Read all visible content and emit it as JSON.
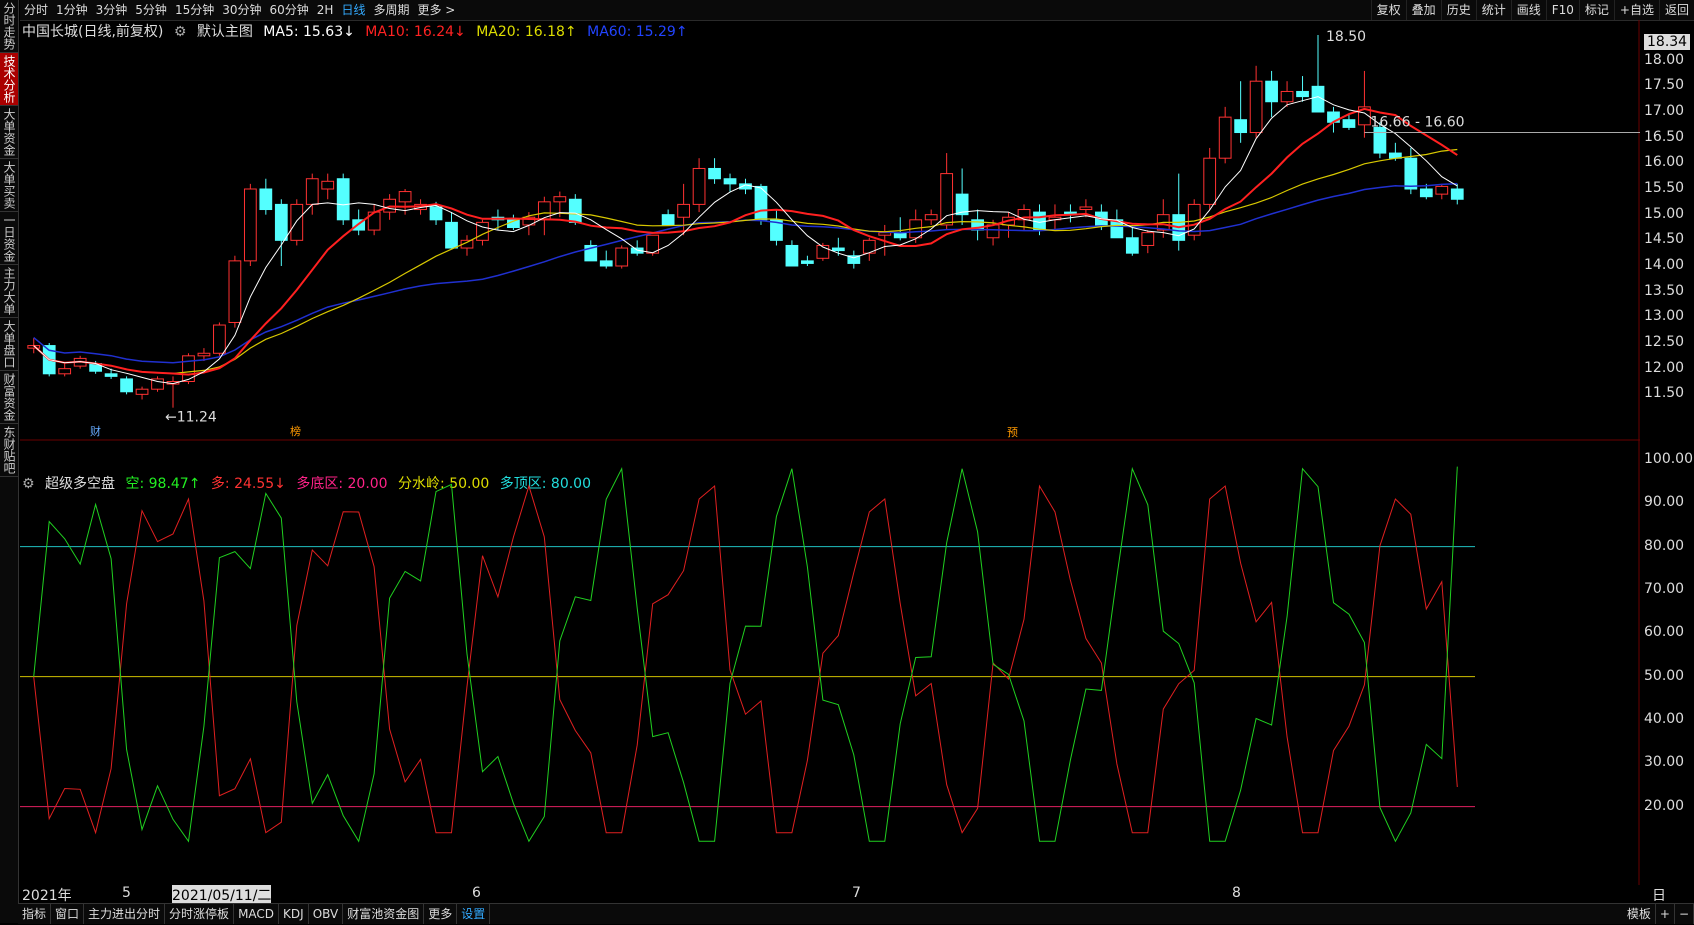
{
  "toolbar": {
    "left_items": [
      "分时",
      "1分钟",
      "3分钟",
      "5分钟",
      "15分钟",
      "30分钟",
      "60分钟",
      "2H",
      "日线",
      "多周期",
      "更多 >"
    ],
    "active_index": 8,
    "right_items": [
      "复权",
      "叠加",
      "历史",
      "统计",
      "画线",
      "F10",
      "标记",
      "+自选",
      "返回"
    ]
  },
  "sidebar": {
    "items": [
      "分时走势",
      "技术分析",
      "大单资金",
      "大单买卖",
      "一日资金",
      "主力大单",
      "大单盘口",
      "财富资金",
      "东财贴吧"
    ],
    "active_index": 1
  },
  "main_legend": {
    "stock": "中国长城(日线,前复权)",
    "template": "默认主图",
    "ma5": "MA5: 15.63↓",
    "ma10": "MA10: 16.24↓",
    "ma20": "MA20: 16.18↑",
    "ma60": "MA60: 15.29↑",
    "colors": {
      "ma5": "#ffffff",
      "ma10": "#ff2020",
      "ma20": "#e0d000",
      "ma60": "#2040ff"
    }
  },
  "sub_legend": {
    "name": "超级多空盘",
    "kong": "空: 98.47↑",
    "duo": "多: 24.55↓",
    "dudi": "多底区: 20.00",
    "fenshui": "分水岭: 50.00",
    "duoding": "多顶区: 80.00",
    "colors": {
      "kong": "#20e020",
      "duo": "#ff3030",
      "dudi": "#ff2080",
      "fenshui": "#e0d000",
      "duoding": "#20d0d0"
    }
  },
  "price_axis": {
    "current": "18.34",
    "ticks": [
      "18.00",
      "17.50",
      "17.00",
      "16.50",
      "16.00",
      "15.50",
      "15.00",
      "14.50",
      "14.00",
      "13.50",
      "13.00",
      "12.50",
      "12.00",
      "11.50"
    ]
  },
  "osc_axis": {
    "ticks": [
      "100.00",
      "90.00",
      "80.00",
      "70.00",
      "60.00",
      "50.00",
      "40.00",
      "30.00",
      "20.00"
    ]
  },
  "annotations": {
    "high": "18.50",
    "low": "11.24",
    "range_label": "16.66 - 16.60",
    "marker_cai": "财",
    "marker_bang": "榜",
    "marker_yu": "预"
  },
  "date_axis": {
    "labels": [
      "2021年",
      "5",
      "2021/05/11/二",
      "6",
      "7",
      "8"
    ],
    "right_label": "日线"
  },
  "bottom_tabs": {
    "items": [
      "指标",
      "窗口",
      "主力进出分时",
      "分时涨停板",
      "MACD",
      "KDJ",
      "OBV",
      "财富池资金图",
      "更多",
      "设置"
    ],
    "active_index": 9,
    "right_items": [
      "模板",
      "+",
      "−"
    ]
  },
  "chart_data": {
    "type": "candlestick",
    "price_range": [
      11.0,
      18.5
    ],
    "candles": [
      [
        12.4,
        12.6,
        12.3,
        12.45
      ],
      [
        12.45,
        12.5,
        11.85,
        11.9
      ],
      [
        11.9,
        12.1,
        11.85,
        12.0
      ],
      [
        12.05,
        12.25,
        12.0,
        12.2
      ],
      [
        12.1,
        12.15,
        11.9,
        11.95
      ],
      [
        11.9,
        12.0,
        11.8,
        11.85
      ],
      [
        11.8,
        11.85,
        11.5,
        11.55
      ],
      [
        11.5,
        11.65,
        11.4,
        11.6
      ],
      [
        11.6,
        11.85,
        11.55,
        11.8
      ],
      [
        11.7,
        11.85,
        11.24,
        11.75
      ],
      [
        11.75,
        12.3,
        11.7,
        12.25
      ],
      [
        12.25,
        12.4,
        12.15,
        12.3
      ],
      [
        12.3,
        12.9,
        12.25,
        12.85
      ],
      [
        12.9,
        14.2,
        12.8,
        14.1
      ],
      [
        14.1,
        15.6,
        14.0,
        15.5
      ],
      [
        15.5,
        15.7,
        15.0,
        15.1
      ],
      [
        15.2,
        15.3,
        14.0,
        14.5
      ],
      [
        14.5,
        15.3,
        14.4,
        15.2
      ],
      [
        15.2,
        15.8,
        15.0,
        15.7
      ],
      [
        15.5,
        15.8,
        15.3,
        15.65
      ],
      [
        15.7,
        15.8,
        14.8,
        14.9
      ],
      [
        14.9,
        15.1,
        14.6,
        14.7
      ],
      [
        14.7,
        15.2,
        14.6,
        15.05
      ],
      [
        15.05,
        15.4,
        14.9,
        15.3
      ],
      [
        15.25,
        15.5,
        15.0,
        15.45
      ],
      [
        15.1,
        15.3,
        15.0,
        15.2
      ],
      [
        15.15,
        15.25,
        14.8,
        14.9
      ],
      [
        14.85,
        15.05,
        14.35,
        14.35
      ],
      [
        14.35,
        14.6,
        14.2,
        14.5
      ],
      [
        14.5,
        14.9,
        14.4,
        14.85
      ],
      [
        14.95,
        15.1,
        14.7,
        14.9
      ],
      [
        14.9,
        15.0,
        14.7,
        14.75
      ],
      [
        14.8,
        15.05,
        14.6,
        14.95
      ],
      [
        14.9,
        15.35,
        14.6,
        15.25
      ],
      [
        15.25,
        15.45,
        14.95,
        15.35
      ],
      [
        15.3,
        15.4,
        14.8,
        14.85
      ],
      [
        14.4,
        14.5,
        14.1,
        14.1
      ],
      [
        14.1,
        14.3,
        13.95,
        14.0
      ],
      [
        14.0,
        14.4,
        13.95,
        14.35
      ],
      [
        14.35,
        14.5,
        14.2,
        14.25
      ],
      [
        14.25,
        14.6,
        14.2,
        14.6
      ],
      [
        15.0,
        15.1,
        14.8,
        14.8
      ],
      [
        14.95,
        15.6,
        14.6,
        15.2
      ],
      [
        15.2,
        16.1,
        15.05,
        15.9
      ],
      [
        15.9,
        16.1,
        15.6,
        15.7
      ],
      [
        15.7,
        15.8,
        15.45,
        15.6
      ],
      [
        15.6,
        15.7,
        15.4,
        15.5
      ],
      [
        15.55,
        15.6,
        14.8,
        14.9
      ],
      [
        14.9,
        15.1,
        14.4,
        14.5
      ],
      [
        14.4,
        14.5,
        14.0,
        14.0
      ],
      [
        14.1,
        14.2,
        14.0,
        14.05
      ],
      [
        14.15,
        14.45,
        14.1,
        14.4
      ],
      [
        14.35,
        14.55,
        14.2,
        14.3
      ],
      [
        14.2,
        14.3,
        13.95,
        14.05
      ],
      [
        14.25,
        14.55,
        14.1,
        14.5
      ],
      [
        14.6,
        14.8,
        14.2,
        14.65
      ],
      [
        14.65,
        14.95,
        14.5,
        14.55
      ],
      [
        14.55,
        15.1,
        14.45,
        14.9
      ],
      [
        14.9,
        15.1,
        14.8,
        15.0
      ],
      [
        14.8,
        16.2,
        14.7,
        15.8
      ],
      [
        15.4,
        15.9,
        14.8,
        15.0
      ],
      [
        14.9,
        15.1,
        14.5,
        14.7
      ],
      [
        14.55,
        14.9,
        14.4,
        14.8
      ],
      [
        14.8,
        15.05,
        14.55,
        14.95
      ],
      [
        14.9,
        15.2,
        14.7,
        15.1
      ],
      [
        15.05,
        15.2,
        14.6,
        14.7
      ],
      [
        14.9,
        15.2,
        14.7,
        14.95
      ],
      [
        15.05,
        15.2,
        14.85,
        15.0
      ],
      [
        15.1,
        15.3,
        14.95,
        15.15
      ],
      [
        15.05,
        15.2,
        14.7,
        14.8
      ],
      [
        14.9,
        15.1,
        14.55,
        14.55
      ],
      [
        14.55,
        14.8,
        14.2,
        14.25
      ],
      [
        14.4,
        14.7,
        14.25,
        14.65
      ],
      [
        14.7,
        15.3,
        14.55,
        15.0
      ],
      [
        15.0,
        15.8,
        14.3,
        14.5
      ],
      [
        14.6,
        15.3,
        14.5,
        15.2
      ],
      [
        15.2,
        16.3,
        15.1,
        16.1
      ],
      [
        16.1,
        17.1,
        16.0,
        16.9
      ],
      [
        16.85,
        17.6,
        16.4,
        16.6
      ],
      [
        16.6,
        17.9,
        16.5,
        17.6
      ],
      [
        17.6,
        17.8,
        16.9,
        17.2
      ],
      [
        17.2,
        17.6,
        17.1,
        17.4
      ],
      [
        17.4,
        17.7,
        17.2,
        17.3
      ],
      [
        17.5,
        18.5,
        17.2,
        17.0
      ],
      [
        17.0,
        17.1,
        16.6,
        16.8
      ],
      [
        16.85,
        16.95,
        16.65,
        16.7
      ],
      [
        16.75,
        17.8,
        16.5,
        17.1
      ],
      [
        16.7,
        16.8,
        16.1,
        16.2
      ],
      [
        16.2,
        16.4,
        16.05,
        16.1
      ],
      [
        16.1,
        16.3,
        15.4,
        15.5
      ],
      [
        15.5,
        15.6,
        15.3,
        15.35
      ],
      [
        15.4,
        15.6,
        15.3,
        15.55
      ],
      [
        15.5,
        15.6,
        15.2,
        15.3
      ]
    ]
  }
}
